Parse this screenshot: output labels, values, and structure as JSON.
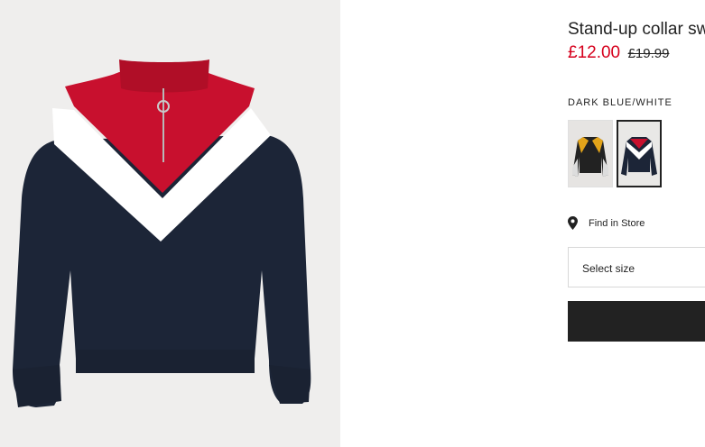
{
  "product": {
    "title": "Stand-up collar sw",
    "sale_price": "£12.00",
    "original_price": "£19.99",
    "color_label": "DARK BLUE/WHITE"
  },
  "swatches": [
    {
      "name": "black-yellow-variant",
      "selected": false
    },
    {
      "name": "dark-blue-white-variant",
      "selected": true
    }
  ],
  "store": {
    "icon": "location-pin-icon",
    "label": "Find in Store"
  },
  "size_select": {
    "value": "Select size"
  },
  "colors": {
    "sale_price": "#d6001c",
    "navy": "#1c2537",
    "red": "#c8102e",
    "white": "#ffffff",
    "image_background": "#efeeed",
    "button": "#222222"
  }
}
